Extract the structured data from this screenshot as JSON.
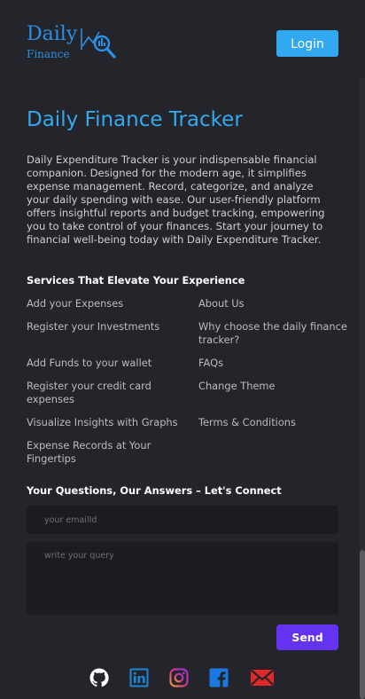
{
  "header": {
    "logo_main": "Daily",
    "logo_sub": "Finance",
    "login_label": "Login"
  },
  "hero": {
    "title": "Daily Finance Tracker",
    "description": "Daily Expenditure Tracker is your indispensable financial companion. Designed for the modern age, it simplifies expense management. Record, categorize, and analyze your daily spending with ease. Our user-friendly platform offers insightful reports and budget tracking, empowering you to take control of your finances. Start your journey to financial well-being today with Daily Expenditure Tracker."
  },
  "services": {
    "heading": "Services That Elevate Your Experience",
    "left": [
      "Add your Expenses",
      "Register your Investments",
      "Add Funds to your wallet",
      "Register your credit card expenses",
      "Visualize Insights with Graphs",
      "Expense Records at Your Fingertips"
    ],
    "right": [
      "About Us",
      "Why choose the daily finance tracker?",
      "FAQs",
      "Change Theme",
      "Terms & Conditions"
    ]
  },
  "contact": {
    "heading": "Your Questions, Our Answers – Let's Connect",
    "email_placeholder": "your emailId",
    "query_placeholder": "write your query",
    "send_label": "Send"
  },
  "social": {
    "icons": [
      "github-icon",
      "linkedin-icon",
      "instagram-icon",
      "facebook-icon",
      "mail-icon"
    ]
  },
  "colors": {
    "background": "#24252a",
    "accent_blue": "#33a9ef",
    "login_button": "#31a8f0",
    "send_button": "#6433f0",
    "input_bg": "#1b1c20"
  }
}
